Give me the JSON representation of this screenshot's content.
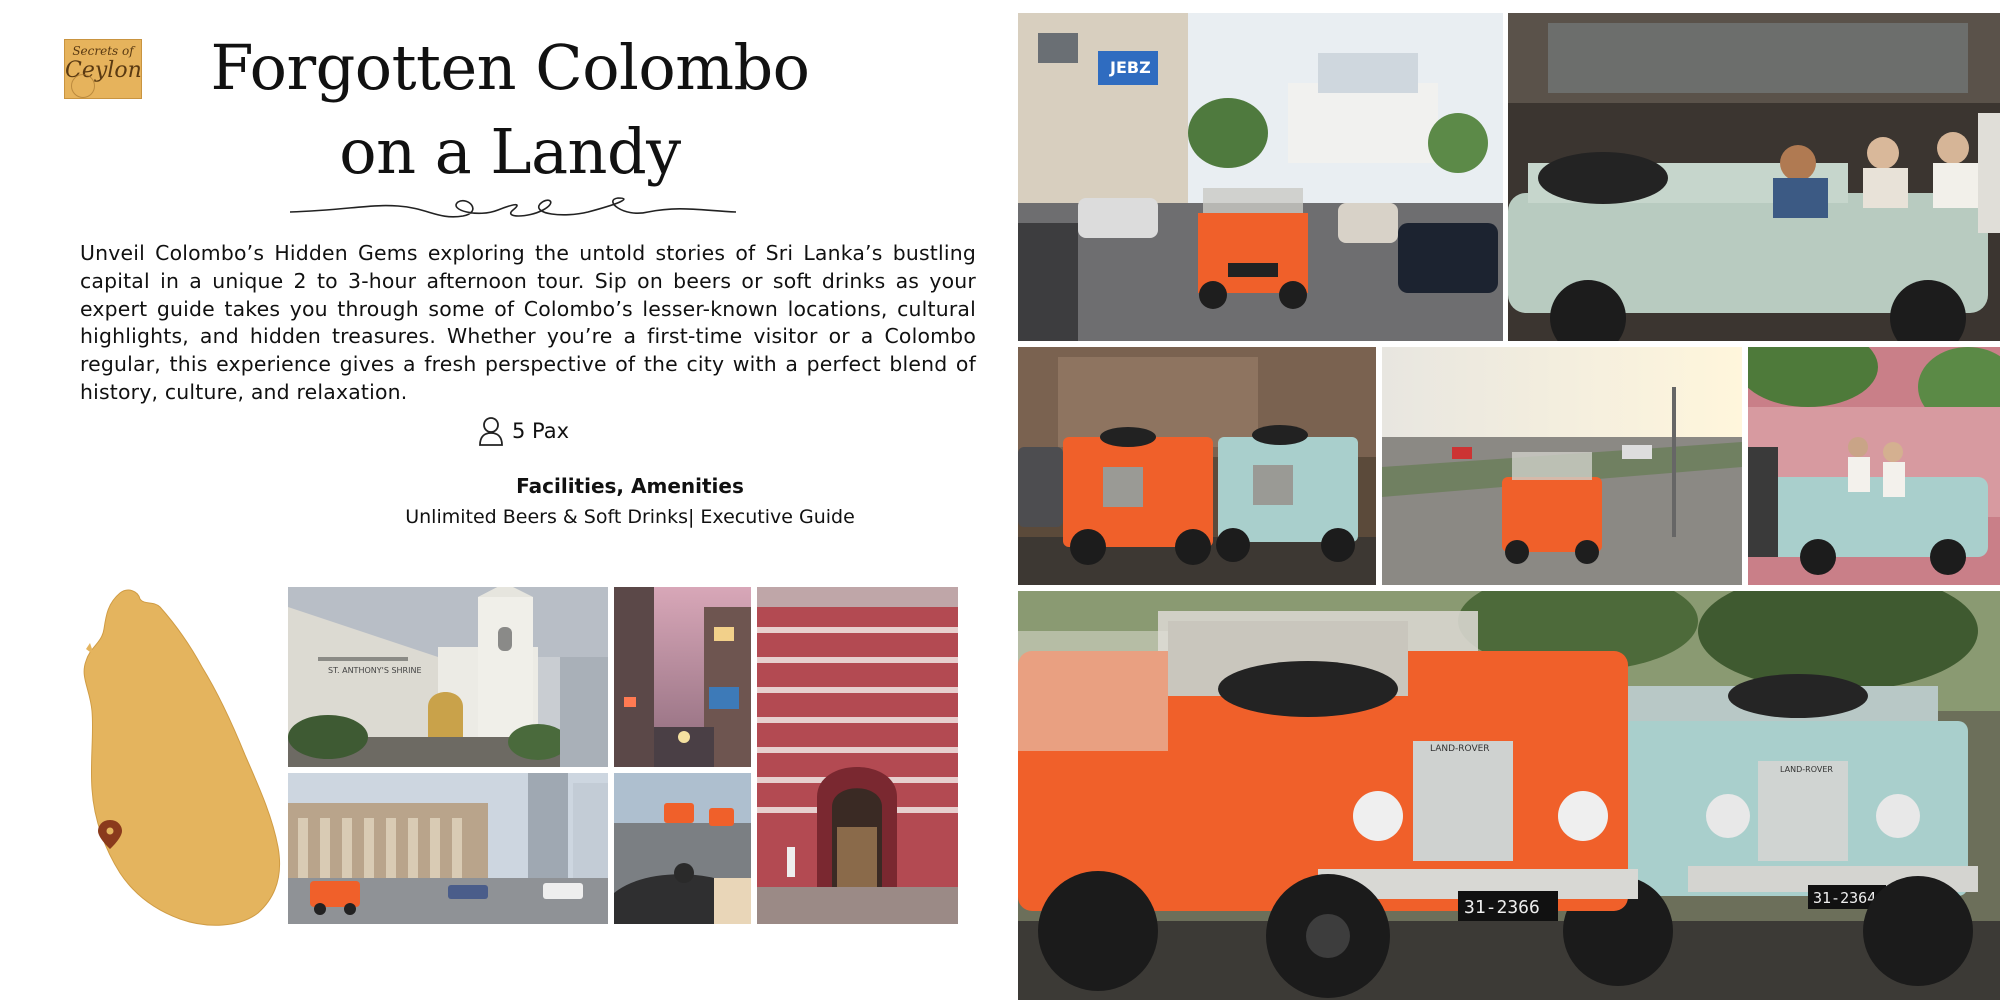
{
  "logo": {
    "line1": "Secrets of",
    "line2": "Ceylon"
  },
  "title": {
    "line1": "Forgotten Colombo",
    "line2": "on a Landy"
  },
  "description": "Unveil Colombo’s Hidden Gems exploring the untold stories of Sri Lanka’s bustling capital in a unique 2 to 3-hour afternoon tour. Sip on beers or soft drinks as your expert guide takes you through some of Colombo’s lesser-known locations, cultural highlights, and hidden treasures. Whether you’re a first-time visitor or a Colombo regular, this experience gives a fresh perspective of the city with a perfect blend of history, culture, and relaxation.",
  "pax": {
    "icon": "person-icon",
    "label": "5 Pax"
  },
  "facilities": {
    "heading": "Facilities, Amenities",
    "text": "Unlimited Beers & Soft Drinks| Executive Guide"
  },
  "map": {
    "icon": "map-pin-icon",
    "land_color": "#e4b45e",
    "pin_color": "#8a3a1c"
  },
  "photos": {
    "church": {
      "sign": "ST. ANTHONY'S SHRINE"
    },
    "street_sign": "JEBZ",
    "plate_orange": "31-2366",
    "plate_blue": "31-2364",
    "badge": "LAND-ROVER"
  },
  "colors": {
    "landy_orange": "#f0602a",
    "landy_blue": "#a9cfcc",
    "landy_sage": "#b8cbc0"
  }
}
